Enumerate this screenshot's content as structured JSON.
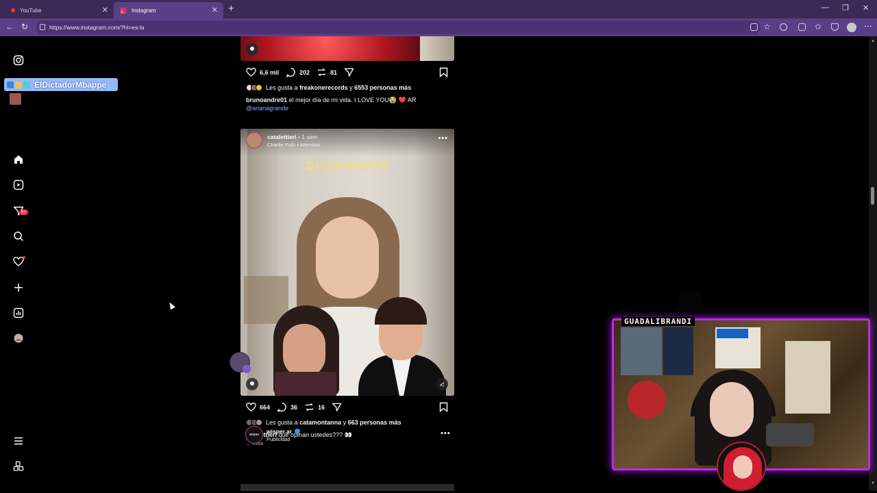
{
  "browser": {
    "tabs": [
      {
        "title": "YouTube",
        "favicon": "youtube-icon",
        "active": false
      },
      {
        "title": "Instagram",
        "favicon": "instagram-icon",
        "active": true
      }
    ],
    "url": "https://www.instagram.com/?hl=es-la"
  },
  "overlay": {
    "twitch_username": "ElDictadorMbappe",
    "streamer_name": "GUADALIBRANDI"
  },
  "sidebar": {
    "items": [
      {
        "name": "instagram-logo-icon"
      },
      {
        "name": "home-icon"
      },
      {
        "name": "reels-icon"
      },
      {
        "name": "direct-messages-icon",
        "badge": "9+"
      },
      {
        "name": "search-icon"
      },
      {
        "name": "notifications-icon",
        "dot": true
      },
      {
        "name": "create-icon"
      },
      {
        "name": "dashboard-icon"
      },
      {
        "name": "profile-icon"
      },
      {
        "name": "more-menu-icon"
      },
      {
        "name": "also-from-meta-icon"
      }
    ]
  },
  "feed": {
    "post1": {
      "likes": "6,6 mil",
      "comments": "202",
      "reposts": "81",
      "liked_by_prefix": "Les gusta a ",
      "liked_by_user": "freakonerecords",
      "liked_by_join": " y ",
      "liked_by_count": "6553 personas más",
      "caption_user": "brunoandre01",
      "caption_text": " el mejor día de mi vida. I LOVE YOU😭 ❤️ AR",
      "mention": "@arianagrande"
    },
    "post2": {
      "user": "catalettieri",
      "time": " • 1 sem",
      "audio": "Charlie Puth • Attention",
      "overlay_text": "DICIÉNDOTE",
      "likes": "664",
      "comments": "36",
      "reposts": "16",
      "liked_by_prefix": "Les gusta a ",
      "liked_by_user": "catamontanna",
      "liked_by_join": " y ",
      "liked_by_count": "663 personas más",
      "caption_user": "catalettieri",
      "caption_text": " que opinan ustedes??? 👀",
      "more": "... más"
    },
    "post3": {
      "user": "wisper.ar",
      "avatar_text": "wisper",
      "subtitle": "Publicidad"
    }
  },
  "colors": {
    "tabbar": "#3b2a55",
    "addrbar": "#5b3f86",
    "accent_red": "#ff3040",
    "link_blue": "#8fa8ff",
    "cam_border": "#c02bd8"
  }
}
